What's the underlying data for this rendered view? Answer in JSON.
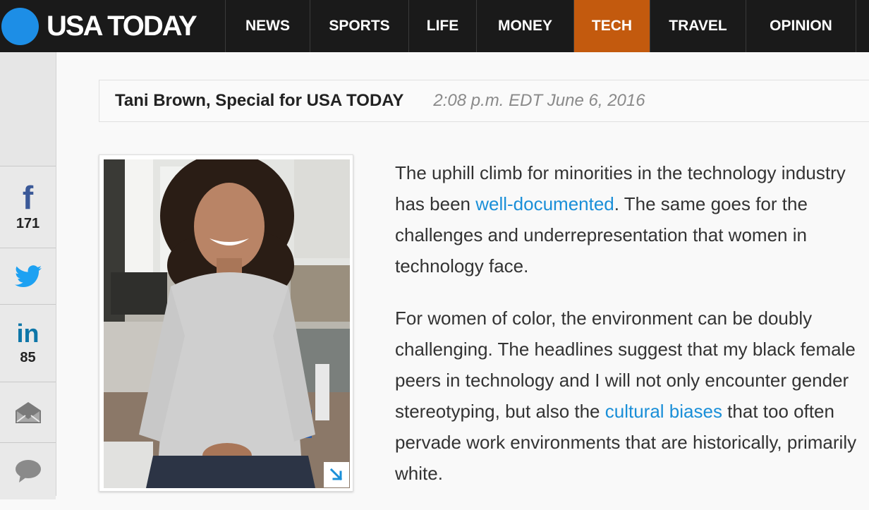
{
  "brand": {
    "name": "USA TODAY",
    "dot_color": "#1d8ee6"
  },
  "nav": {
    "items": [
      {
        "label": "NEWS",
        "active": false
      },
      {
        "label": "SPORTS",
        "active": false
      },
      {
        "label": "LIFE",
        "active": false
      },
      {
        "label": "MONEY",
        "active": false
      },
      {
        "label": "TECH",
        "active": true
      },
      {
        "label": "TRAVEL",
        "active": false
      },
      {
        "label": "OPINION",
        "active": false
      }
    ],
    "active_color": "#c35a0e"
  },
  "share": {
    "facebook": {
      "icon": "facebook-icon",
      "count": "171"
    },
    "twitter": {
      "icon": "twitter-icon"
    },
    "linkedin": {
      "icon": "linkedin-icon",
      "count": "85"
    },
    "email": {
      "icon": "email-icon"
    },
    "comments": {
      "icon": "comment-icon"
    }
  },
  "byline": {
    "author": "Tani Brown, Special for USA TODAY",
    "timestamp": "2:08 p.m. EDT June 6, 2016"
  },
  "photo": {
    "expand_icon": "expand-arrow-icon"
  },
  "article": {
    "p1": {
      "before": "The uphill climb for minorities in the technology industry has been ",
      "link": "well-documented",
      "after": ". The same goes for the challenges and underrepresentation that women in technology face."
    },
    "p2": {
      "before": "For women of color, the environment can be doubly challenging. The headlines suggest that my black female peers in technology and I will not only encounter gender stereotyping, but also the ",
      "link": "cultural biases",
      "after": " that too often pervade work environments that are historically, primarily white."
    },
    "link_color": "#1a8fd8"
  }
}
